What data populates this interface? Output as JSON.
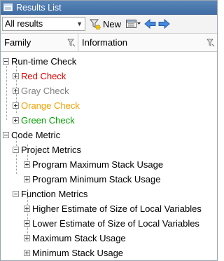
{
  "window": {
    "title": "Results List"
  },
  "toolbar": {
    "filter_value": "All results",
    "new_label": "New"
  },
  "columns": {
    "family": "Family",
    "information": "Information"
  },
  "colors": {
    "red": "#e00000",
    "gray": "#808080",
    "orange": "#f0a000",
    "green": "#00a000",
    "title_bar": "#4a78ad"
  },
  "tree": {
    "runtime": {
      "label": "Run-time Check",
      "children": [
        {
          "label": "Red Check",
          "color": "red"
        },
        {
          "label": "Gray Check",
          "color": "gray"
        },
        {
          "label": "Orange Check",
          "color": "orange"
        },
        {
          "label": "Green Check",
          "color": "green"
        }
      ]
    },
    "code_metric": {
      "label": "Code Metric",
      "project": {
        "label": "Project Metrics",
        "children": [
          "Program Maximum Stack Usage",
          "Program Minimum Stack Usage"
        ]
      },
      "function": {
        "label": "Function Metrics",
        "children": [
          "Higher Estimate of Size of Local Variables",
          "Lower Estimate of Size of Local Variables",
          "Maximum Stack Usage",
          "Minimum Stack Usage"
        ]
      }
    }
  }
}
